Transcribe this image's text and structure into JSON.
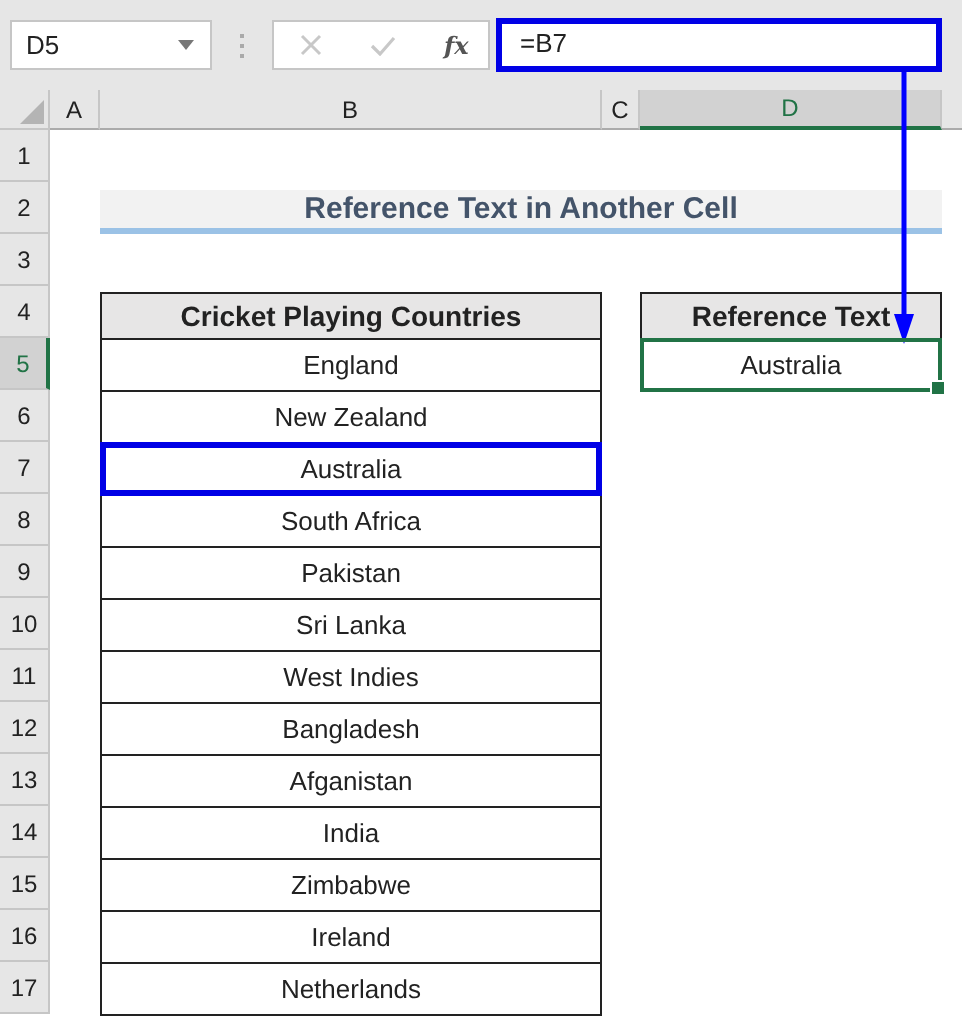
{
  "formula_bar": {
    "name_box": "D5",
    "function_label": "fx",
    "formula": "=B7",
    "highlighted": true
  },
  "columns": [
    {
      "label": "A",
      "selected": false
    },
    {
      "label": "B",
      "selected": false
    },
    {
      "label": "C",
      "selected": false
    },
    {
      "label": "D",
      "selected": true
    }
  ],
  "rows": [
    {
      "label": "1",
      "selected": false
    },
    {
      "label": "2",
      "selected": false
    },
    {
      "label": "3",
      "selected": false
    },
    {
      "label": "4",
      "selected": false
    },
    {
      "label": "5",
      "selected": true
    },
    {
      "label": "6",
      "selected": false
    },
    {
      "label": "7",
      "selected": false
    },
    {
      "label": "8",
      "selected": false
    },
    {
      "label": "9",
      "selected": false
    },
    {
      "label": "10",
      "selected": false
    },
    {
      "label": "11",
      "selected": false
    },
    {
      "label": "12",
      "selected": false
    },
    {
      "label": "13",
      "selected": false
    },
    {
      "label": "14",
      "selected": false
    },
    {
      "label": "15",
      "selected": false
    },
    {
      "label": "16",
      "selected": false
    },
    {
      "label": "17",
      "selected": false
    }
  ],
  "title": "Reference Text in Another Cell",
  "countries_table": {
    "header": "Cricket Playing Countries",
    "rows": [
      {
        "value": "England",
        "highlighted": false
      },
      {
        "value": "New Zealand",
        "highlighted": false
      },
      {
        "value": "Australia",
        "highlighted": true
      },
      {
        "value": "South Africa",
        "highlighted": false
      },
      {
        "value": "Pakistan",
        "highlighted": false
      },
      {
        "value": "Sri Lanka",
        "highlighted": false
      },
      {
        "value": "West Indies",
        "highlighted": false
      },
      {
        "value": "Bangladesh",
        "highlighted": false
      },
      {
        "value": "Afganistan",
        "highlighted": false
      },
      {
        "value": "India",
        "highlighted": false
      },
      {
        "value": "Zimbabwe",
        "highlighted": false
      },
      {
        "value": "Ireland",
        "highlighted": false
      },
      {
        "value": "Netherlands",
        "highlighted": false
      }
    ]
  },
  "reference_table": {
    "header": "Reference Text",
    "value": "Australia",
    "selected": true
  }
}
